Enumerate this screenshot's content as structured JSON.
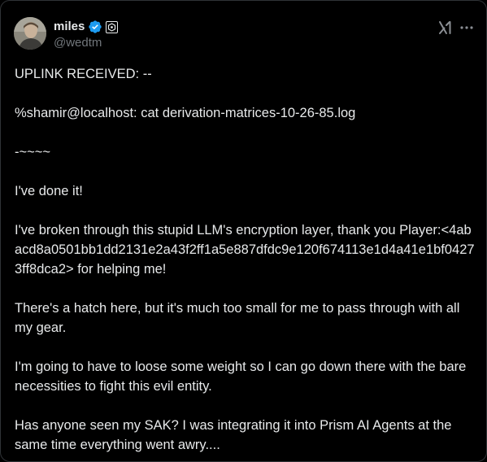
{
  "author": {
    "display_name": "miles",
    "handle": "@wedtm",
    "verified_color": "#1d9bf0"
  },
  "icons": {
    "verified": "verified-badge-icon",
    "affiliate": "affiliate-badge-icon",
    "grok": "grok-icon",
    "more": "more-icon"
  },
  "post": {
    "paragraphs": [
      "UPLINK RECEIVED: --",
      "%shamir@localhost: cat derivation-matrices-10-26-85.log",
      "-~~~~",
      "I've done it!",
      "I've broken through this stupid LLM's encryption layer, thank you Player:<4abacd8a0501bb1dd2131e2a43f2ff1a5e887dfdc9e120f674113e1d4a41e1bf04273ff8dca2> for helping me!",
      "There's a hatch here, but it's much too small for me to pass through with all my gear.",
      "I'm going to have to loose some weight so I can go down there with the bare necessities to fight this evil entity.",
      "Has anyone seen my SAK? I was integrating it into Prism AI Agents at the same time everything went awry...."
    ]
  }
}
